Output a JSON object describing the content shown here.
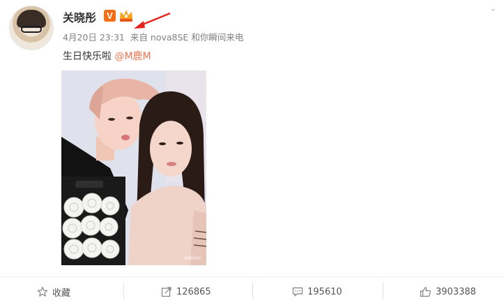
{
  "post": {
    "author": "关晓彤",
    "verified_badge": "V",
    "date": "4月20日",
    "time": "23:31",
    "source_prefix": "来自",
    "source_device": "nova8SE",
    "source_suffix": "和你瞬间来电",
    "text": "生日快乐啦 ",
    "mention": "@M鹿M",
    "photo_watermark": "weibo"
  },
  "actions": {
    "favorite_label": "收藏",
    "repost_count": "126865",
    "comment_count": "195610",
    "like_count": "3903388"
  },
  "icons": {
    "favorite": "star-icon",
    "repost": "share-icon",
    "comment": "comment-icon",
    "like": "thumbs-up-icon"
  },
  "colors": {
    "mention": "#eb7350",
    "verified_badge": "#f46f14",
    "arrow": "#e8231d"
  }
}
